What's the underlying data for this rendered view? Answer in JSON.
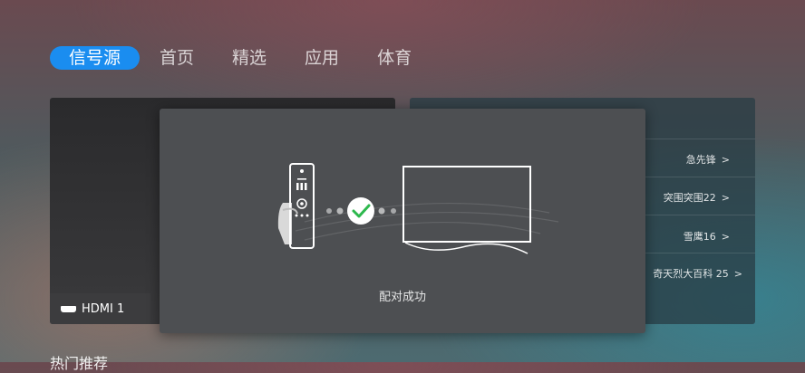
{
  "tabs": [
    {
      "label": "信号源",
      "active": true
    },
    {
      "label": "首页"
    },
    {
      "label": "精选"
    },
    {
      "label": "应用"
    },
    {
      "label": "体育"
    }
  ],
  "left_panel": {
    "input_label": "HDMI 1"
  },
  "right_panel": {
    "items": [
      "急先锋",
      "突围突围22",
      "雪鹰16",
      "奇天烈大百科 25"
    ]
  },
  "section_title": "热门推荐",
  "dialog": {
    "status": "配对成功"
  },
  "colors": {
    "active_tab": "#1a8df0",
    "check_circle": "#ffffff",
    "check_mark": "#2db84d"
  }
}
